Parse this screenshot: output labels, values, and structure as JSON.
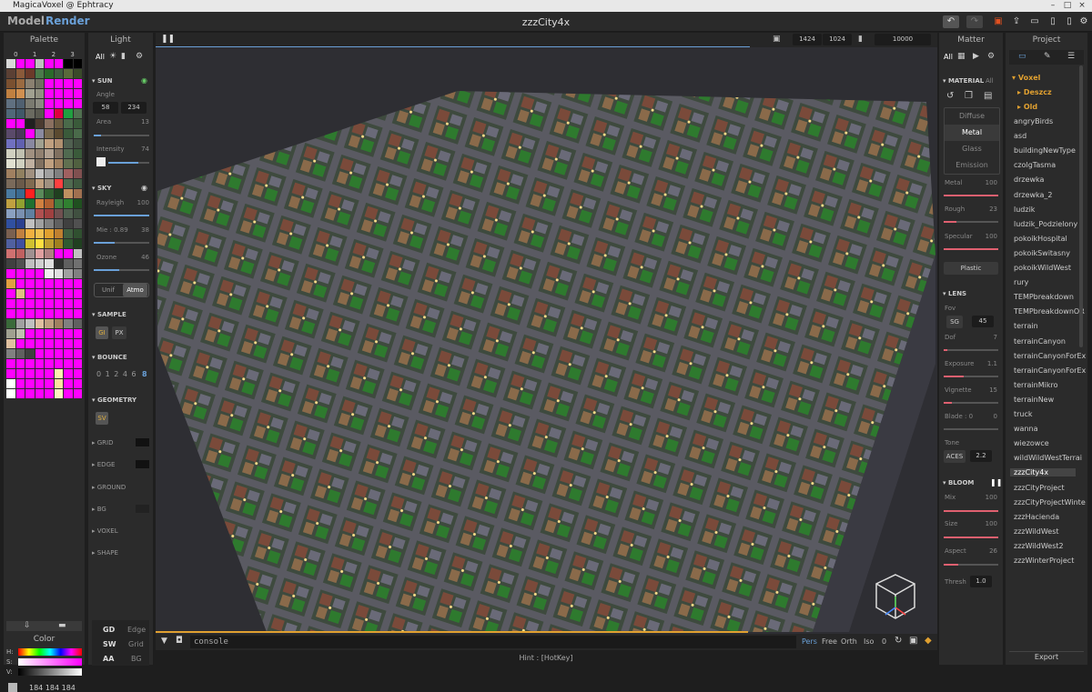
{
  "window": {
    "title": "MagicaVoxel @ Ephtracy"
  },
  "modes": {
    "model": "Model",
    "render": "Render"
  },
  "file_title": "zzzCity4x",
  "palette": {
    "title": "Palette",
    "tabs": [
      "0",
      "1",
      "2",
      "3"
    ],
    "colors": [
      "#d8d8d8",
      "#ff00ff",
      "#ff00ff",
      "#c0c0c0",
      "#ff00ff",
      "#ff00ff",
      "#000",
      "#000",
      "#5b4034",
      "#8a5a3a",
      "#6b3a2a",
      "#4a7a4a",
      "#2a6a2a",
      "#3e5e3e",
      "#5a6a3a",
      "#3a4a2a",
      "#7a5030",
      "#9a6a40",
      "#8a8070",
      "#707060",
      "#ff00ff",
      "#ff00ff",
      "#ff00ff",
      "#ff00ff",
      "#c08040",
      "#d09050",
      "#a0a090",
      "#909080",
      "#ff00ff",
      "#ff00ff",
      "#ff00ff",
      "#ff00ff",
      "#607080",
      "#506070",
      "#7a7a70",
      "#8a8a80",
      "#ff00ff",
      "#ff00ff",
      "#ff00ff",
      "#ff00ff",
      "#506878",
      "#405868",
      "#6a6a60",
      "#5a5a50",
      "#ff00ff",
      "#e00040",
      "#20a040",
      "#507050",
      "#ff00ff",
      "#ff00ff",
      "#202020",
      "#4a3a30",
      "#8a7060",
      "#6a5a40",
      "#4a6a4a",
      "#3a5a3a",
      "#5a4a6a",
      "#4a3a5a",
      "#ff00ff",
      "#8a8aa0",
      "#7a6a50",
      "#5a4a30",
      "#3a5a3a",
      "#4a6a4a",
      "#7070c0",
      "#6060b0",
      "#8888a0",
      "#a0a090",
      "#c0a080",
      "#b09070",
      "#506050",
      "#405040",
      "#d0d0c0",
      "#c0c0b0",
      "#a09080",
      "#908070",
      "#b0a090",
      "#807060",
      "#506a50",
      "#3a5a3a",
      "#e0e0d0",
      "#d0d0c0",
      "#c0b0a0",
      "#807060",
      "#c0a080",
      "#a08060",
      "#607050",
      "#506040",
      "#a08060",
      "#908060",
      "#a09080",
      "#c0c0c0",
      "#a0a0a0",
      "#808080",
      "#a06060",
      "#805050",
      "#7a6a5a",
      "#6a5a4a",
      "#806a50",
      "#c0a080",
      "#a09080",
      "#ff4040",
      "#506a50",
      "#405a40",
      "#4a7aa0",
      "#3a6a90",
      "#ff2020",
      "#5a8a5a",
      "#306030",
      "#204020",
      "#c09060",
      "#a07050",
      "#c0a040",
      "#90a030",
      "#207030",
      "#d08040",
      "#b06030",
      "#408040",
      "#308030",
      "#205020",
      "#8aa0c0",
      "#7a90b0",
      "#6080a0",
      "#b05050",
      "#a04040",
      "#705050",
      "#506050",
      "#405040",
      "#3050a0",
      "#2a4090",
      "#c0c0c0",
      "#a0a0a0",
      "#808080",
      "#606060",
      "#404040",
      "#505050",
      "#7a6050",
      "#c08040",
      "#f0b040",
      "#f0c050",
      "#e0a030",
      "#c08030",
      "#406040",
      "#305030",
      "#5060a0",
      "#4050a0",
      "#d0c030",
      "#ffe040",
      "#c0a030",
      "#a08020",
      "#305a30",
      "#204020",
      "#d07070",
      "#c06060",
      "#a09090",
      "#e0a0a0",
      "#b08080",
      "#ff00ff",
      "#ff00ff",
      "#c0c0c0",
      "#404040",
      "#505050",
      "#c0c0c0",
      "#d0d0d0",
      "#e0e0e0",
      "#303030",
      "#606060",
      "#707070",
      "#ff00ff",
      "#ff00ff",
      "#ff00ff",
      "#ff00ff",
      "#f0f0f0",
      "#e0e0e0",
      "#a0a0a0",
      "#808080",
      "#e0a040",
      "#ff00ff",
      "#ff00ff",
      "#ff00ff",
      "#ff00ff",
      "#ff00ff",
      "#ff00ff",
      "#ff00ff",
      "#ff00ff",
      "#e0c080",
      "#ff00ff",
      "#ff00ff",
      "#ff00ff",
      "#ff00ff",
      "#ff00ff",
      "#ff00ff",
      "#ff00ff",
      "#ff00ff",
      "#ff00ff",
      "#ff00ff",
      "#ff00ff",
      "#ff00ff",
      "#ff00ff",
      "#ff00ff",
      "#ff00ff",
      "#ff00ff",
      "#ff00ff",
      "#ff00ff",
      "#ff00ff",
      "#ff00ff",
      "#ff00ff",
      "#ff00ff",
      "#3a6a3a",
      "#a0a0a0",
      "#c0c0c0",
      "#e0c0a0",
      "#c0a080",
      "#a08060",
      "#808080",
      "#606060",
      "#a0a090",
      "#c0c0b0",
      "#ff00ff",
      "#ff00ff",
      "#ff00ff",
      "#ff00ff",
      "#ff00ff",
      "#ff00ff",
      "#e0c0a0",
      "#ff00ff",
      "#ff00ff",
      "#ff00ff",
      "#ff00ff",
      "#ff00ff",
      "#ff00ff",
      "#ff00ff",
      "#808080",
      "#606060",
      "#404040",
      "#ff00ff",
      "#ff00ff",
      "#ff00ff",
      "#ff00ff",
      "#ff00ff",
      "#ff00ff",
      "#ff00ff",
      "#ff00ff",
      "#ff00ff",
      "#ff00ff",
      "#ff00ff",
      "#ff00ff",
      "#ff00ff",
      "#ff00ff",
      "#ff00ff",
      "#ff00ff",
      "#ff00ff",
      "#ff00ff",
      "#fff0b0",
      "#ff00ff",
      "#ff00ff",
      "#fff",
      "#ff00ff",
      "#ff00ff",
      "#ff00ff",
      "#ff00ff",
      "#ffe0a0",
      "#ff00ff",
      "#ff00ff",
      "#fff",
      "#ff00ff",
      "#ff00ff",
      "#ff00ff",
      "#ff00ff",
      "#fff0c0",
      "#ff00ff",
      "#ff00ff"
    ],
    "color_title": "Color",
    "hsv": {
      "h": "H:",
      "s": "S:",
      "v": "V:"
    },
    "rgb": "184 184 184"
  },
  "light": {
    "title": "Light",
    "all": "All",
    "sun": {
      "label": "SUN",
      "angle_label": "Angle",
      "angle_a": "58",
      "angle_b": "234",
      "area_label": "Area",
      "area_value": "13",
      "area_level": 0.13,
      "intensity_label": "Intensity",
      "intensity_value": "74",
      "intensity_level": 0.74
    },
    "sky": {
      "label": "SKY",
      "rayleigh_label": "Rayleigh",
      "rayleigh_value": "100",
      "rayleigh_level": 1.0,
      "mie_label": "Mie : 0.89",
      "mie_value": "38",
      "mie_level": 0.38,
      "ozone_label": "Ozone",
      "ozone_value": "46",
      "ozone_level": 0.46,
      "unif": "Unif",
      "atmo": "Atmo"
    },
    "sample": {
      "label": "SAMPLE",
      "gi": "GI",
      "px": "PX"
    },
    "bounce": {
      "label": "BOUNCE",
      "values": "0 1 2 4 6",
      "selected": "8"
    },
    "geometry": {
      "label": "GEOMETRY",
      "sv": "SV"
    },
    "grid": "GRID",
    "edge": "EDGE",
    "ground": "GROUND",
    "bg": "BG",
    "voxel": "VOXEL",
    "shape": "SHAPE",
    "bottom": {
      "gd": "GD",
      "edge": "Edge",
      "sw": "SW",
      "grid": "Grid",
      "aa": "AA",
      "bg": "BG"
    }
  },
  "viewport": {
    "res_w": "1424",
    "res_h": "1024",
    "samples": "10000",
    "console_placeholder": "console",
    "cam_modes": [
      "Pers",
      "Free",
      "Orth",
      "Iso"
    ],
    "cam_value": "0",
    "progress": 0.76
  },
  "matter": {
    "title": "Matter",
    "all": "All",
    "material": {
      "label": "MATERIAL",
      "all": "All"
    },
    "types": [
      "Diffuse",
      "Metal",
      "Glass",
      "Emission"
    ],
    "selected": "Metal",
    "metal_label": "Metal",
    "metal_value": "100",
    "metal_level": 1.0,
    "rough_label": "Rough",
    "rough_value": "23",
    "rough_level": 0.23,
    "specular_label": "Specular",
    "specular_value": "100",
    "specular_level": 1.0,
    "plastic": "Plastic",
    "lens": {
      "label": "LENS",
      "fov_label": "Fov",
      "fov_mode": "SG",
      "fov_value": "45",
      "dof_label": "Dof",
      "dof_value": "7",
      "dof_level": 0.07,
      "exposure_label": "Exposure",
      "exposure_value": "1.1",
      "exposure_level": 0.36,
      "vignette_label": "Vignette",
      "vignette_value": "15",
      "vignette_level": 0.15,
      "blade_label": "Blade : 0",
      "blade_value": "0",
      "blade_level": 0.0,
      "tone_label": "Tone",
      "tone_mode": "ACES",
      "tone_value": "2.2"
    },
    "bloom": {
      "label": "BLOOM",
      "mix_label": "Mix",
      "mix_value": "100",
      "mix_level": 1.0,
      "size_label": "Size",
      "size_value": "100",
      "size_level": 1.0,
      "aspect_label": "Aspect",
      "aspect_value": "26",
      "aspect_level": 0.26,
      "thresh_label": "Thresh",
      "thresh_value": "1.0"
    }
  },
  "project": {
    "title": "Project",
    "folders": [
      "Voxel",
      "Deszcz",
      "Old"
    ],
    "items": [
      "angryBirds",
      "asd",
      "buildingNewType",
      "czolgTasma",
      "drzewka",
      "drzewka_2",
      "ludzik",
      "ludzik_Podzielony",
      "pokoikHospital",
      "pokoikSwitasny",
      "pokoikWildWest",
      "rury",
      "TEMPbreakdown",
      "TEMPbreakdownOR",
      "terrain",
      "terrainCanyon",
      "terrainCanyonForEx",
      "terrainCanyonForEx",
      "terrainMikro",
      "terrainNew",
      "truck",
      "wanna",
      "wiezowce",
      "wildWildWestTerrai",
      "zzzCity4x",
      "zzzCityProject",
      "zzzCityProjectWinte",
      "zzzHacienda",
      "zzzWildWest",
      "zzzWildWest2",
      "zzzWinterProject"
    ],
    "selected": "zzzCity4x",
    "export": "Export"
  },
  "hint": "Hint : [HotKey]",
  "colors": {
    "accent": "#6aa0d8",
    "selected_tab": "#ffffff",
    "render_mode": "#6aa0d8",
    "folder": "#e0a030"
  }
}
